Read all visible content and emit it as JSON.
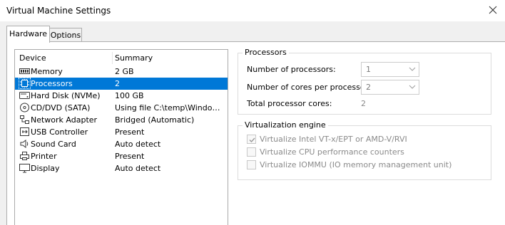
{
  "window": {
    "title": "Virtual Machine Settings",
    "close_icon": "close-icon"
  },
  "tabs": [
    {
      "label": "Hardware",
      "active": true
    },
    {
      "label": "Options",
      "active": false
    }
  ],
  "device_list": {
    "columns": [
      "Device",
      "Summary"
    ],
    "rows": [
      {
        "name": "Memory",
        "summary": "2 GB",
        "icon": "memory-icon",
        "selected": false
      },
      {
        "name": "Processors",
        "summary": "2",
        "icon": "processor-icon",
        "selected": true
      },
      {
        "name": "Hard Disk (NVMe)",
        "summary": "100 GB",
        "icon": "hard-disk-icon",
        "selected": false
      },
      {
        "name": "CD/DVD (SATA)",
        "summary": "Using file C:\\temp\\Windows_...",
        "icon": "cd-dvd-icon",
        "selected": false
      },
      {
        "name": "Network Adapter",
        "summary": "Bridged (Automatic)",
        "icon": "network-adapter-icon",
        "selected": false
      },
      {
        "name": "USB Controller",
        "summary": "Present",
        "icon": "usb-icon",
        "selected": false
      },
      {
        "name": "Sound Card",
        "summary": "Auto detect",
        "icon": "speaker-icon",
        "selected": false
      },
      {
        "name": "Printer",
        "summary": "Present",
        "icon": "printer-icon",
        "selected": false
      },
      {
        "name": "Display",
        "summary": "Auto detect",
        "icon": "monitor-icon",
        "selected": false
      }
    ]
  },
  "processors": {
    "group_title": "Processors",
    "num_processors_label": "Number of processors:",
    "num_processors_value": "1",
    "cores_label": "Number of cores per processor:",
    "cores_value": "2",
    "total_label": "Total processor cores:",
    "total_value": "2"
  },
  "virtualization": {
    "group_title": "Virtualization engine",
    "options": [
      {
        "label": "Virtualize Intel VT-x/EPT or AMD-V/RVI",
        "checked": true,
        "enabled": false
      },
      {
        "label": "Virtualize CPU performance counters",
        "checked": false,
        "enabled": false
      },
      {
        "label": "Virtualize IOMMU (IO memory management unit)",
        "checked": false,
        "enabled": false
      }
    ]
  },
  "colors": {
    "selection": "#0078d7",
    "disabled_text": "#8a8a8a"
  }
}
